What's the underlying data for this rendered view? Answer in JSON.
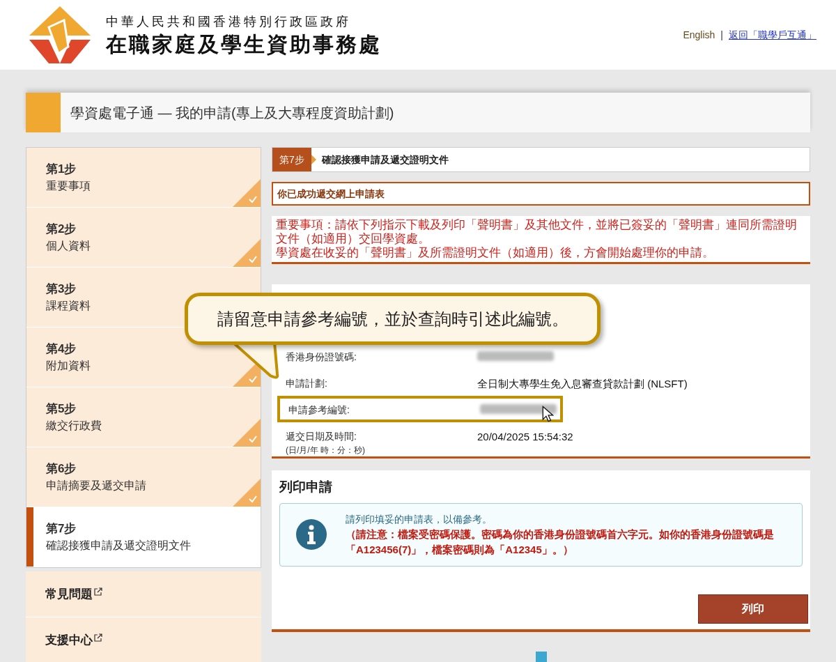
{
  "header": {
    "org_line_1": "中華人民共和國香港特別行政區政府",
    "org_line_2": "在職家庭及學生資助事務處",
    "separator": "|",
    "links": [
      {
        "label": "English",
        "kind": "lang"
      },
      {
        "label": "返回「職學戶互通」",
        "kind": "link"
      }
    ]
  },
  "page_title": "學資處電子通 — 我的申請(專上及大專程度資助計劃)",
  "steps": [
    {
      "number": "第1步",
      "label": "重要事項",
      "completed": true,
      "selected": false
    },
    {
      "number": "第2步",
      "label": "個人資料",
      "completed": true,
      "selected": false
    },
    {
      "number": "第3步",
      "label": "課程資料",
      "selected": false
    },
    {
      "number": "第4步",
      "label": "附加資料",
      "completed": true,
      "selected": false
    },
    {
      "number": "第5步",
      "label": "繳交行政費",
      "completed": true,
      "selected": false
    },
    {
      "number": "第6步",
      "label": "申請摘要及遞交申請",
      "completed": true,
      "selected": false
    },
    {
      "number": "第7步",
      "label": "確認接獲申請及遞交證明文件",
      "completed": false,
      "selected": true
    }
  ],
  "side_links": [
    "常見問題",
    "支援中心"
  ],
  "step_header": {
    "badge": "第7步",
    "title": "確認接獲申請及遞交證明文件"
  },
  "success_message": "你已成功遞交網上申請表",
  "notice_lines": [
    "重要事項：請依下列指示下載及列印「聲明書」及其他文件，並將已簽妥的「聲明書」連同所需證明文件（如適用）交回學資處。",
    "學資處在收妥的「聲明書」及所需證明文件（如適用）後，方會開始處理你的申請。"
  ],
  "summary_rows": [
    {
      "label": "香港身份證號碼:",
      "blurred": true,
      "highlighted": false
    },
    {
      "label": "申請計劃:",
      "value": "全日制大專學生免入息審查貸款計劃 (NLSFT)",
      "blurred": false,
      "highlighted": false
    },
    {
      "label": "申請參考編號:",
      "blurred": true,
      "highlighted": true
    },
    {
      "label": "遞交日期及時間:",
      "sublabel": "(日/月/年 時：分：秒)",
      "value": "20/04/2025 15:54:32",
      "blurred": false,
      "highlighted": false
    }
  ],
  "callout": "請留意申請參考編號，並於查詢時引述此編號。",
  "print_section": {
    "title": "列印申請",
    "info": "請列印填妥的申請表，以備參考。",
    "warning": "（請注意：檔案受密碼保護。密碼為你的香港身份證號碼首六字元。如你的香港身份證號碼是「A123456(7)」，檔案密碼則為「A12345」。）",
    "button": "列印"
  }
}
